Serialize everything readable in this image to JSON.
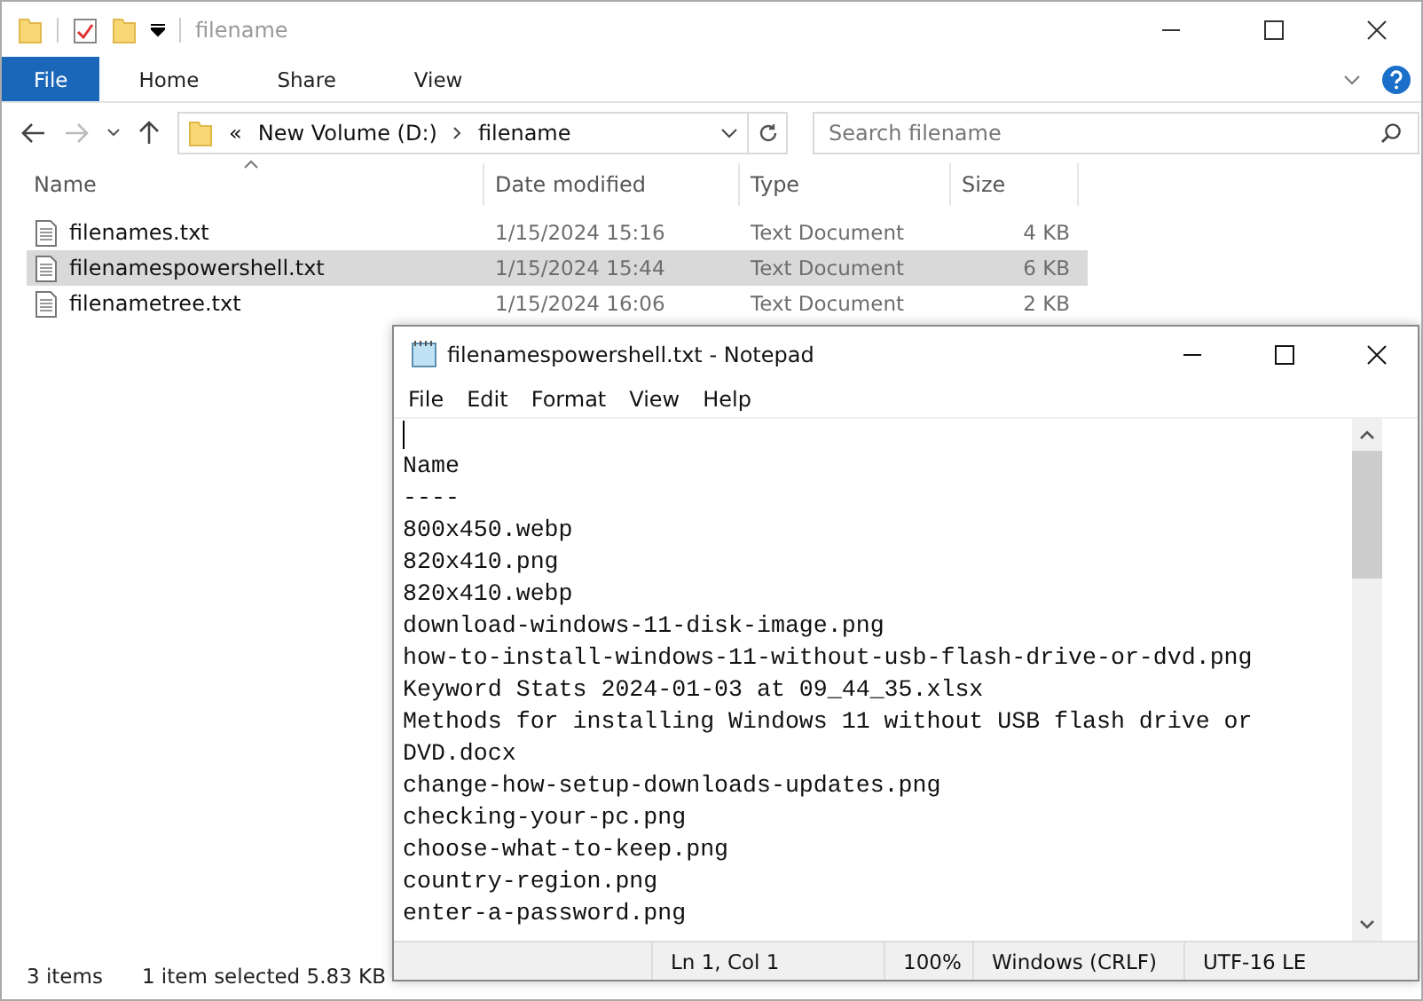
{
  "explorer": {
    "title": "filename",
    "ribbon_tabs": [
      {
        "label": "File",
        "selected": true
      },
      {
        "label": "Home",
        "selected": false
      },
      {
        "label": "Share",
        "selected": false
      },
      {
        "label": "View",
        "selected": false
      }
    ],
    "address": {
      "overflow": "«",
      "segments": [
        "New Volume (D:)",
        "filename"
      ]
    },
    "search": {
      "placeholder": "Search filename"
    },
    "columns": [
      "Name",
      "Date modified",
      "Type",
      "Size"
    ],
    "files": [
      {
        "name": "filenames.txt",
        "date": "1/15/2024 15:16",
        "type": "Text Document",
        "size": "4 KB",
        "selected": false
      },
      {
        "name": "filenamespowershell.txt",
        "date": "1/15/2024 15:44",
        "type": "Text Document",
        "size": "6 KB",
        "selected": true
      },
      {
        "name": "filenametree.txt",
        "date": "1/15/2024 16:06",
        "type": "Text Document",
        "size": "2 KB",
        "selected": false
      }
    ],
    "status_bar": {
      "count": "3 items",
      "selection": "1 item selected  5.83 KB"
    }
  },
  "notepad": {
    "title": "filenamespowershell.txt - Notepad",
    "menu": [
      "File",
      "Edit",
      "Format",
      "View",
      "Help"
    ],
    "lines": [
      "Name",
      "----",
      "800x450.webp",
      "820x410.png",
      "820x410.webp",
      "download-windows-11-disk-image.png",
      "how-to-install-windows-11-without-usb-flash-drive-or-dvd.png",
      "Keyword Stats 2024-01-03 at 09_44_35.xlsx",
      "Methods for installing Windows 11 without USB flash drive or DVD.docx",
      "change-how-setup-downloads-updates.png",
      "checking-your-pc.png",
      "choose-what-to-keep.png",
      "country-region.png",
      "enter-a-password.png"
    ],
    "status_bar": [
      "Ln 1, Col 1",
      "100%",
      "Windows (CRLF)",
      "UTF-16 LE"
    ]
  }
}
